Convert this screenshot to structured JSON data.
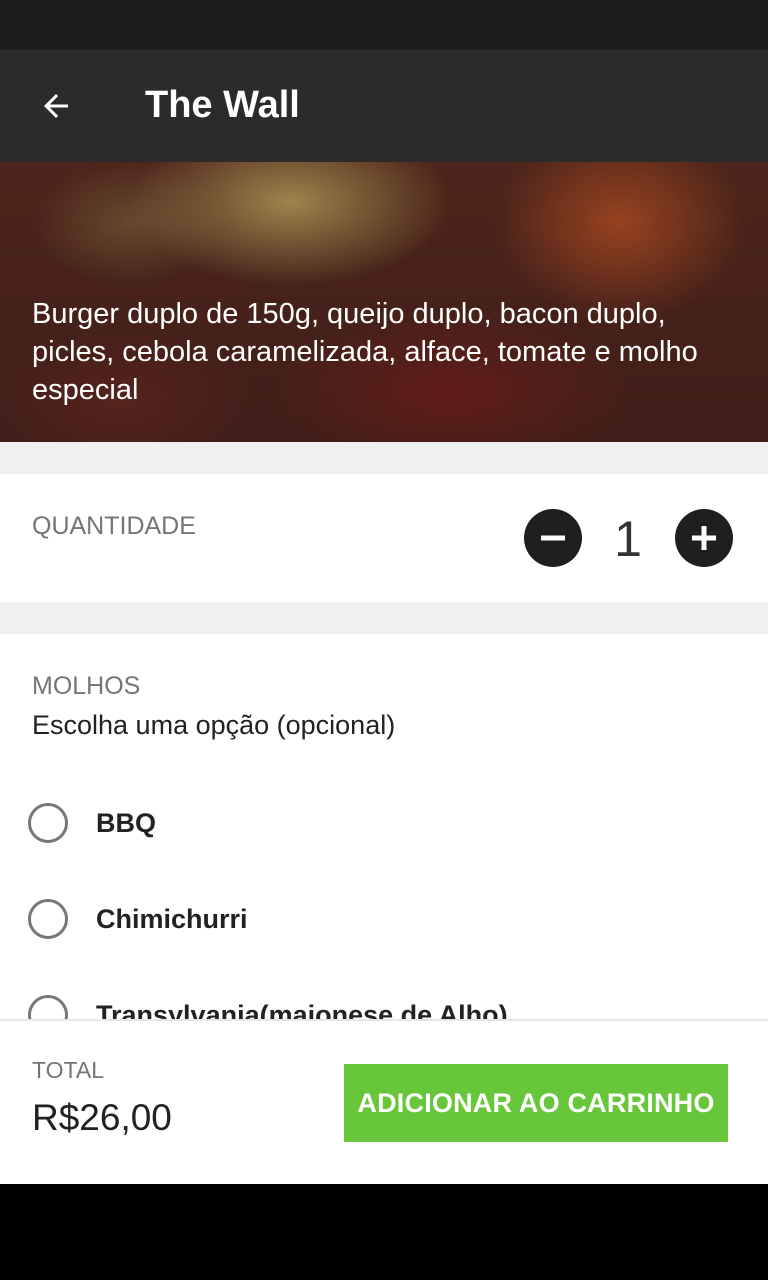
{
  "toolbar": {
    "title": "The Wall",
    "back_icon": "arrow-left-icon"
  },
  "product": {
    "description": "Burger duplo  de 150g,  queijo duplo, bacon duplo, picles, cebola caramelizada, alface, tomate e molho especial"
  },
  "quantity": {
    "label": "QUANTIDADE",
    "value": "1",
    "decrement_icon": "minus-circle-icon",
    "increment_icon": "plus-circle-icon"
  },
  "sauces": {
    "title": "MOLHOS",
    "subtitle": "Escolha uma opção (opcional)",
    "options": [
      {
        "label": "BBQ",
        "selected": false
      },
      {
        "label": "Chimichurri",
        "selected": false
      },
      {
        "label": "Transylvania(maionese de Alho)",
        "selected": false
      }
    ]
  },
  "footer": {
    "total_label": "TOTAL",
    "total_value": "R$26,00",
    "add_button": "ADICIONAR AO CARRINHO"
  },
  "colors": {
    "toolbar": "#2b2b2b",
    "accent_green": "#67c639",
    "status_bar": "#1d1d1d"
  }
}
